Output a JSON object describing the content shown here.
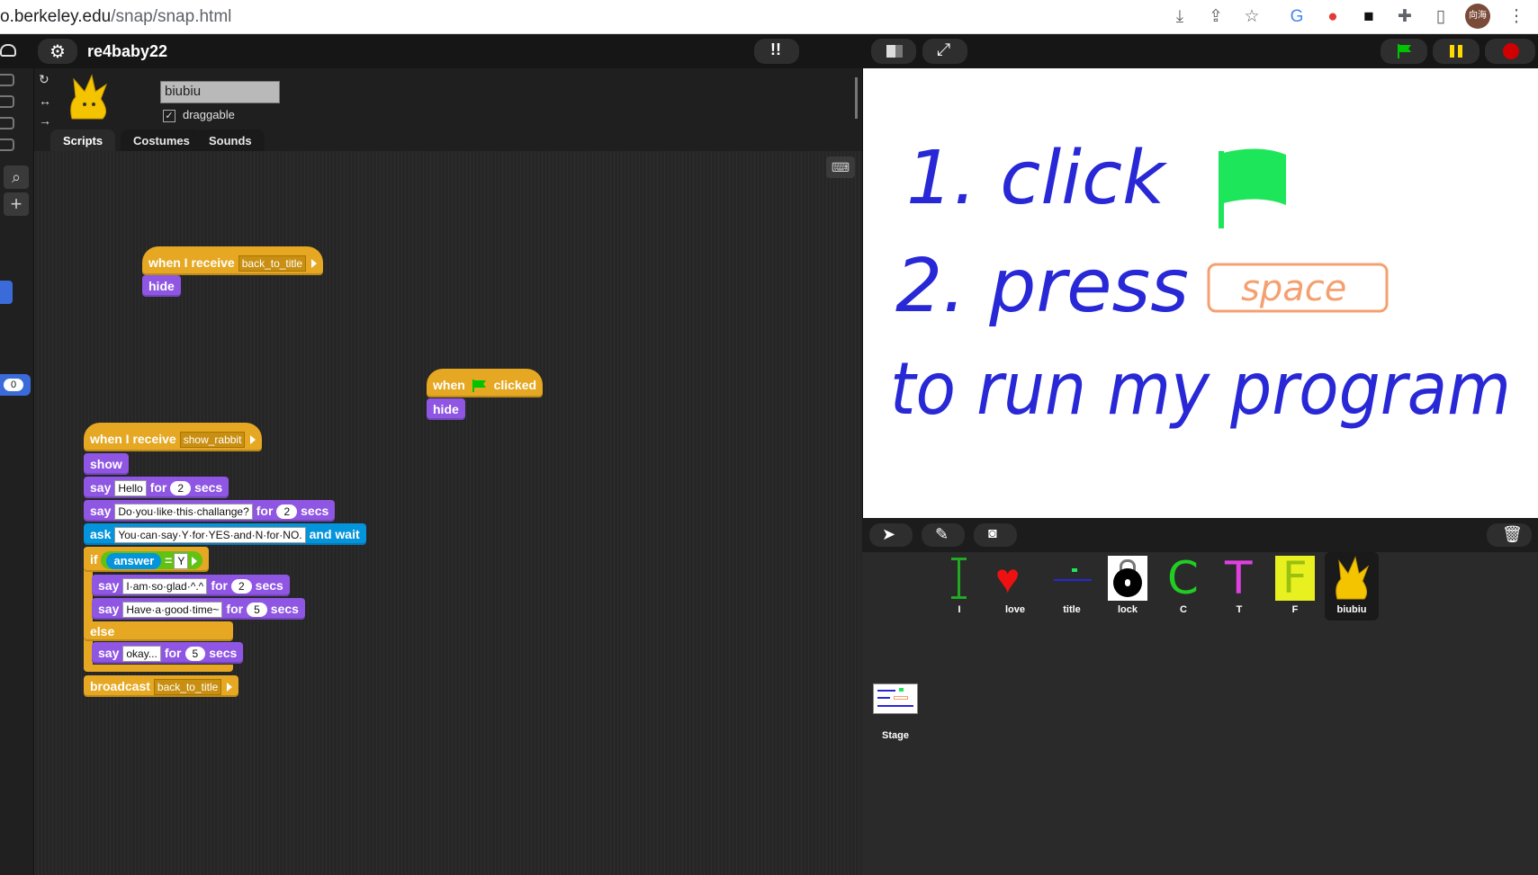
{
  "browser": {
    "url_prefix": "o.berkeley.edu",
    "url_path": "/snap/snap.html",
    "avatar_text": "向海"
  },
  "topbar": {
    "project_name": "re4baby22"
  },
  "sprite": {
    "name": "biubiu",
    "draggable_label": "draggable",
    "draggable_checked": "✓"
  },
  "tabs": [
    "Scripts",
    "Costumes",
    "Sounds"
  ],
  "palette": {
    "counter_value": "0"
  },
  "scripts": {
    "s1": {
      "hat": "when I receive",
      "msg": "back_to_title",
      "b1": "hide"
    },
    "s2": {
      "when": "when",
      "clicked": "clicked",
      "b1": "hide"
    },
    "s3": {
      "hat": "when I receive",
      "msg": "show_rabbit",
      "show": "show",
      "say": "say",
      "for": "for",
      "secs": "secs",
      "say1_text": "Hello",
      "say1_secs": "2",
      "say2_text": "Do·you·like·this·challange?",
      "say2_secs": "2",
      "ask": "ask",
      "ask_text": "You·can·say·Y·for·YES·and·N·for·NO.",
      "and_wait": "and wait",
      "if": "if",
      "answer": "answer",
      "eq": "=",
      "y": "Y",
      "say3_text": "I·am·so·glad·^.^",
      "say3_secs": "2",
      "say4_text": "Have·a·good·time~",
      "say4_secs": "5",
      "else": "else",
      "say5_text": "okay...",
      "say5_secs": "5",
      "broadcast": "broadcast",
      "broadcast_msg": "back_to_title"
    }
  },
  "stage": {
    "line1": "1. click",
    "line2": "2. press",
    "space": "space",
    "line3": "to run my program"
  },
  "corral": {
    "sprites": [
      {
        "name": "I"
      },
      {
        "name": "love"
      },
      {
        "name": "title"
      },
      {
        "name": "lock"
      },
      {
        "name": "C"
      },
      {
        "name": "T"
      },
      {
        "name": "F"
      },
      {
        "name": "biubiu"
      }
    ],
    "stage_label": "Stage"
  },
  "colors": {
    "looks": "#8f56e3",
    "control": "#e6a822",
    "sensing": "#0494dc",
    "operators": "#62c213",
    "green_flag": "#00c400",
    "pause": "#ffd800",
    "stop": "#d00000",
    "ink_blue": "#2828d6",
    "flag_green": "#1ee65a",
    "space_orange": "#f4a070"
  }
}
